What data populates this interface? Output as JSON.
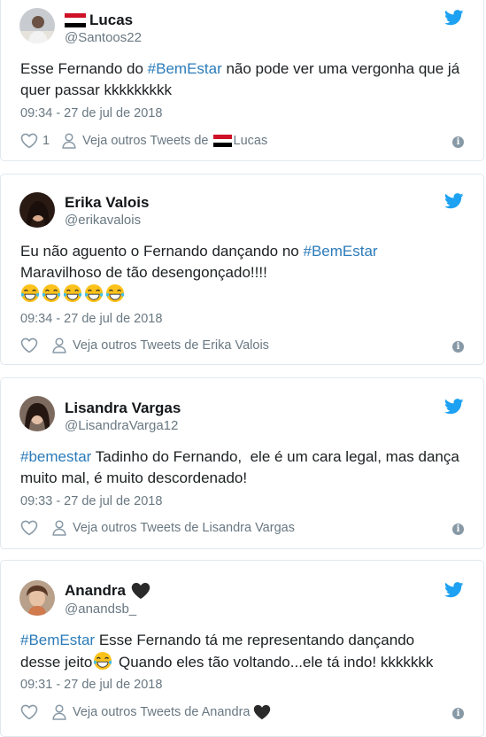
{
  "tweets": [
    {
      "name": "Lucas",
      "handle": "@Santoos22",
      "text_pre": "Esse Fernando do ",
      "hashtag": "#BemEstar",
      "text_post": " não pode ver uma vergonha que já quer passar kkkkkkkkk",
      "timestamp": "09:34 - 27 de jul de 2018",
      "like_count": "1",
      "more_tweets_label": "Veja outros Tweets de",
      "more_tweets_name": "Lucas"
    },
    {
      "name": "Erika Valois",
      "handle": "@erikavalois",
      "text_pre": "Eu não aguento o Fernando dançando no ",
      "hashtag": "#BemEstar",
      "text_line2": "Maravilhoso de tão desengonçado!!!!",
      "timestamp": "09:34 - 27 de jul de 2018",
      "more_tweets": "Veja outros Tweets de Erika Valois"
    },
    {
      "name": "Lisandra Vargas",
      "handle": "@LisandraVarga12",
      "hashtag": "#bemestar",
      "text_post": " Tadinho do Fernando,  ele é um cara legal, mas dança muito mal, é muito descordenado!",
      "timestamp": "09:33 - 27 de jul de 2018",
      "more_tweets": "Veja outros Tweets de Lisandra Vargas"
    },
    {
      "name": "Anandra",
      "handle": "@anandsb_",
      "hashtag": "#BemEstar",
      "text_post": " Esse Fernando tá me representando dançando",
      "text_line2_pre": "desse jeito",
      "text_line2_post": " Quando eles tão voltando...ele tá indo! kkkkkkk",
      "timestamp": "09:31 - 27 de jul de 2018",
      "more_tweets": "Veja outros Tweets de Anandra"
    }
  ],
  "colors": {
    "hashtag": "#2b7bb9",
    "twitter_blue": "#1da1f2",
    "meta_gray": "#697882"
  },
  "icons": [
    "twitter-bird-icon",
    "heart-icon",
    "person-icon",
    "info-icon",
    "flag-icon",
    "black-heart-emoji",
    "laughing-crying-emoji"
  ]
}
